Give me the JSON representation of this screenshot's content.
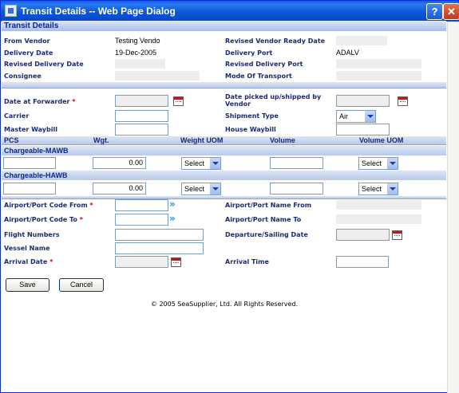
{
  "window": {
    "title": "Transit Details -- Web Page Dialog",
    "help_glyph": "?",
    "close_glyph": "✕"
  },
  "header": {
    "title": "Transit Details"
  },
  "vendor": {
    "from_vendor_label": "From Vendor",
    "from_vendor_value": "Testing Vendo",
    "delivery_date_label": "Delivery Date",
    "delivery_date_value": "19-Dec-2005",
    "revised_delivery_date_label": "Revised Delivery Date",
    "consignee_label": "Consignee",
    "revised_ready_date_label": "Revised Vendor Ready Date",
    "delivery_port_label": "Delivery Port",
    "delivery_port_value": "ADALV",
    "revised_delivery_port_label": "Revised Delivery Port",
    "mode_of_transport_label": "Mode Of Transport"
  },
  "forwarder": {
    "date_at_forwarder_label": "Date at Forwarder",
    "required_mark": "*",
    "carrier_label": "Carrier",
    "master_waybill_label": "Master Waybill",
    "date_picked_label_1": "Date picked up/shipped by",
    "date_picked_label_2": "Vendor",
    "shipment_type_label": "Shipment Type",
    "shipment_type_value": "Air",
    "house_waybill_label": "House Waybill"
  },
  "columns": {
    "pcs": "PCS",
    "wgt": "Wgt.",
    "weight_uom": "Weight UOM",
    "volume": "Volume",
    "volume_uom": "Volume UOM"
  },
  "mawb": {
    "title": "Chargeable-MAWB",
    "wgt_value": "0.00",
    "weight_uom_value": "Select",
    "volume_uom_value": "Select"
  },
  "hawb": {
    "title": "Chargeable-HAWB",
    "wgt_value": "0.00",
    "weight_uom_value": "Select",
    "volume_uom_value": "Select"
  },
  "route": {
    "port_from_label": "Airport/Port Code From",
    "port_to_label": "Airport/Port Code To",
    "flight_numbers_label": "Flight Numbers",
    "vessel_name_label": "Vessel Name",
    "arrival_date_label": "Arrival Date",
    "port_name_from_label": "Airport/Port Name From",
    "port_name_to_label": "Airport/Port Name To",
    "departure_date_label": "Departure/Sailing Date",
    "arrival_time_label": "Arrival Time",
    "arrow_glyph": "»"
  },
  "actions": {
    "save_label": "Save",
    "cancel_label": "Cancel"
  },
  "footer": {
    "copyright": "© 2005 SeaSupplier, Ltd. All Rights Reserved."
  }
}
